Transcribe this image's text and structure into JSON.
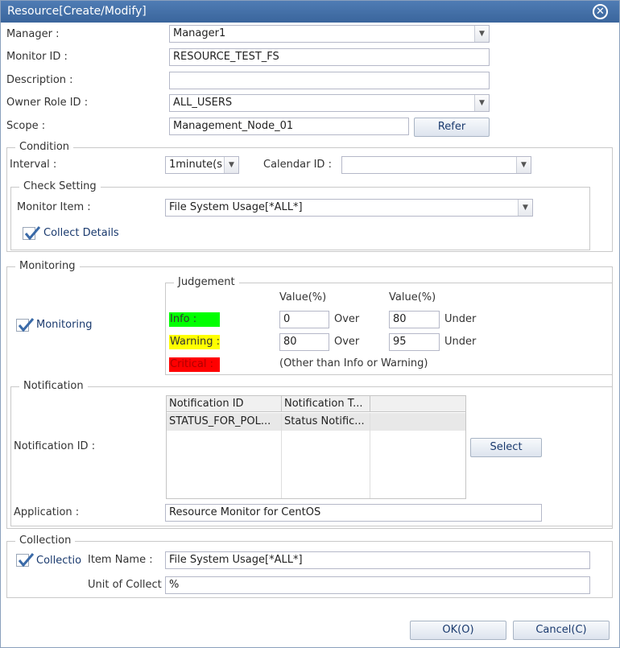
{
  "window": {
    "title": "Resource[Create/Modify]",
    "close_icon": "⊗"
  },
  "form": {
    "manager_label": "Manager :",
    "manager_value": "Manager1",
    "monitor_id_label": "Monitor ID :",
    "monitor_id_value": "RESOURCE_TEST_FS",
    "description_label": "Description :",
    "description_value": "",
    "owner_role_label": "Owner Role ID :",
    "owner_role_value": "ALL_USERS",
    "scope_label": "Scope :",
    "scope_value": "Management_Node_01",
    "refer_button": "Refer"
  },
  "condition": {
    "legend": "Condition",
    "interval_label": "Interval :",
    "interval_value": "1minute(s",
    "calendar_label": "Calendar ID :",
    "calendar_value": "",
    "check_setting": {
      "legend": "Check Setting",
      "monitor_item_label": "Monitor Item :",
      "monitor_item_value": "File System Usage[*ALL*]",
      "collect_details_label": "Collect Details",
      "collect_details_checked": true
    }
  },
  "monitoring": {
    "legend": "Monitoring",
    "monitoring_label": "Monitoring",
    "monitoring_checked": true,
    "judgement": {
      "legend": "Judgement",
      "value_header_1": "Value(%)",
      "value_header_2": "Value(%)",
      "info_label": "Info :",
      "info_color": "#00ff00",
      "info_over": "0",
      "info_under": "80",
      "warning_label": "Warning :",
      "warning_color": "#ffff00",
      "warning_over": "80",
      "warning_under": "95",
      "critical_label": "Critical :",
      "critical_color": "#ff0000",
      "over_label": "Over",
      "under_label": "Under",
      "critical_note": "(Other than Info or Warning)"
    },
    "notification": {
      "legend": "Notification",
      "notification_id_label": "Notification ID :",
      "columns": [
        "Notification ID",
        "Notification T..."
      ],
      "rows": [
        [
          "STATUS_FOR_POL...",
          "Status Notific..."
        ]
      ],
      "select_button": "Select",
      "application_label": "Application :",
      "application_value": "Resource Monitor for CentOS"
    }
  },
  "collection": {
    "legend": "Collection",
    "collection_label": "Collectio",
    "collection_checked": true,
    "item_name_label": "Item Name :",
    "item_name_value": "File System Usage[*ALL*]",
    "unit_label": "Unit of Collect",
    "unit_value": "%"
  },
  "footer": {
    "ok_button": "OK(O)",
    "cancel_button": "Cancel(C)"
  }
}
